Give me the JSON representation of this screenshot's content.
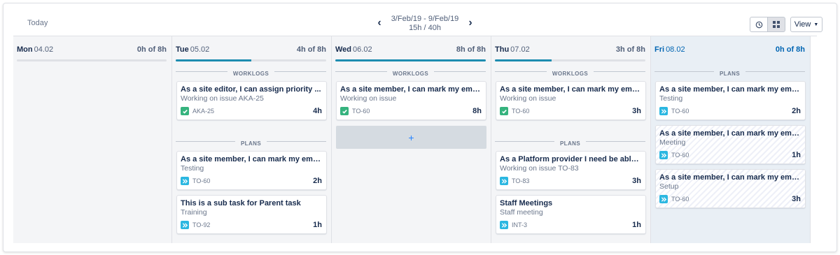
{
  "toolbar": {
    "today_label": "Today",
    "range": "3/Feb/19 - 9/Feb/19",
    "total": "15h / 40h",
    "view_label": "View",
    "clock_icon": "clock-icon",
    "grid_icon": "grid-icon"
  },
  "days": [
    {
      "name": "Mon",
      "date": "04.02",
      "hours": "0h of 8h",
      "progress": 0.0
    },
    {
      "name": "Tue",
      "date": "05.02",
      "hours": "4h of 8h",
      "progress": 0.5,
      "worklogs_label": "WORKLOGS",
      "plans_label": "PLANS",
      "worklogs": [
        {
          "title": "As a site editor, I can assign priority ...",
          "subtitle": "Working on issue AKA-25",
          "key": "AKA-25",
          "hours": "4h"
        }
      ],
      "plans": [
        {
          "title": "As a site member, I can mark my email ...",
          "subtitle": "Testing",
          "key": "TO-60",
          "hours": "2h"
        },
        {
          "title": "This is a sub task for Parent task",
          "subtitle": "Training",
          "key": "TO-92",
          "hours": "1h"
        }
      ]
    },
    {
      "name": "Wed",
      "date": "06.02",
      "hours": "8h of 8h",
      "progress": 1.0,
      "worklogs_label": "WORKLOGS",
      "add_label": "+",
      "worklogs": [
        {
          "title": "As a site member, I can mark my email ...",
          "subtitle": "Working on issue",
          "key": "TO-60",
          "hours": "8h"
        }
      ]
    },
    {
      "name": "Thu",
      "date": "07.02",
      "hours": "3h of 8h",
      "progress": 0.375,
      "worklogs_label": "WORKLOGS",
      "plans_label": "PLANS",
      "worklogs": [
        {
          "title": "As a site member, I can mark my email ...",
          "subtitle": "Working on issue",
          "key": "TO-60",
          "hours": "3h"
        }
      ],
      "plans": [
        {
          "title": "As a Platform provider I need be able to ...",
          "subtitle": "Working on issue TO-83",
          "key": "TO-83",
          "hours": "3h"
        },
        {
          "title": "Staff Meetings",
          "subtitle": "Staff meeting",
          "key": "INT-3",
          "hours": "1h"
        }
      ]
    },
    {
      "name": "Fri",
      "date": "08.02",
      "hours": "0h of 8h",
      "progress": 0.0,
      "plans_label": "PLANS",
      "plans": [
        {
          "title": "As a site member, I can mark my email ...",
          "subtitle": "Testing",
          "key": "TO-60",
          "hours": "2h"
        },
        {
          "title": "As a site member, I can mark my email ...",
          "subtitle": "Meeting",
          "key": "TO-60",
          "hours": "1h"
        },
        {
          "title": "As a site member, I can mark my email ...",
          "subtitle": "Setup",
          "key": "TO-60",
          "hours": "3h"
        }
      ]
    }
  ],
  "colors": {
    "accent": "#1d8cb0",
    "check": "#36b37e",
    "subtask": "#2bb7e1",
    "today": "#0065b3"
  }
}
